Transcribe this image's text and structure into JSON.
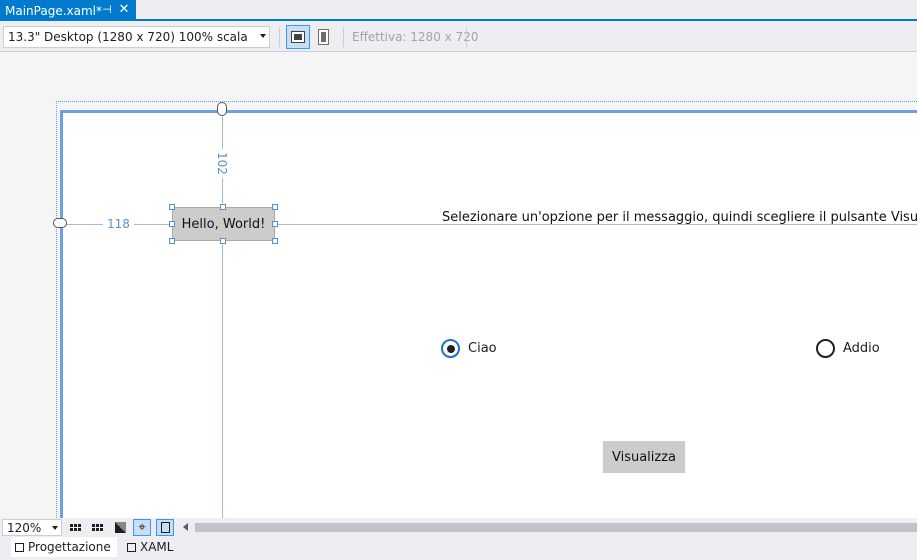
{
  "tab": {
    "title": "MainPage.xaml*",
    "pin_icon": "pin-icon",
    "close_icon": "close-icon"
  },
  "toolbar": {
    "device": "13.3\" Desktop (1280 x 720) 100% scala",
    "effective": "Effettiva: 1280 x 720"
  },
  "designer": {
    "margin_top_label": "102",
    "margin_left_label": "118",
    "hello_button": "Hello, World!",
    "instructions": "Selezionare un'opzione per il messaggio, quindi scegliere il pulsante Visualizza.",
    "radio_hello": {
      "label": "Ciao",
      "checked": true
    },
    "radio_goodbye": {
      "label": "Addio",
      "checked": false
    },
    "show_button": "Visualizza"
  },
  "zoom": {
    "value": "120%"
  },
  "view_tabs": {
    "design": "Progettazione",
    "xaml": "XAML"
  },
  "colors": {
    "accent": "#007acc",
    "guide": "#6f9ee2",
    "measure_text": "#5a8fd8"
  }
}
